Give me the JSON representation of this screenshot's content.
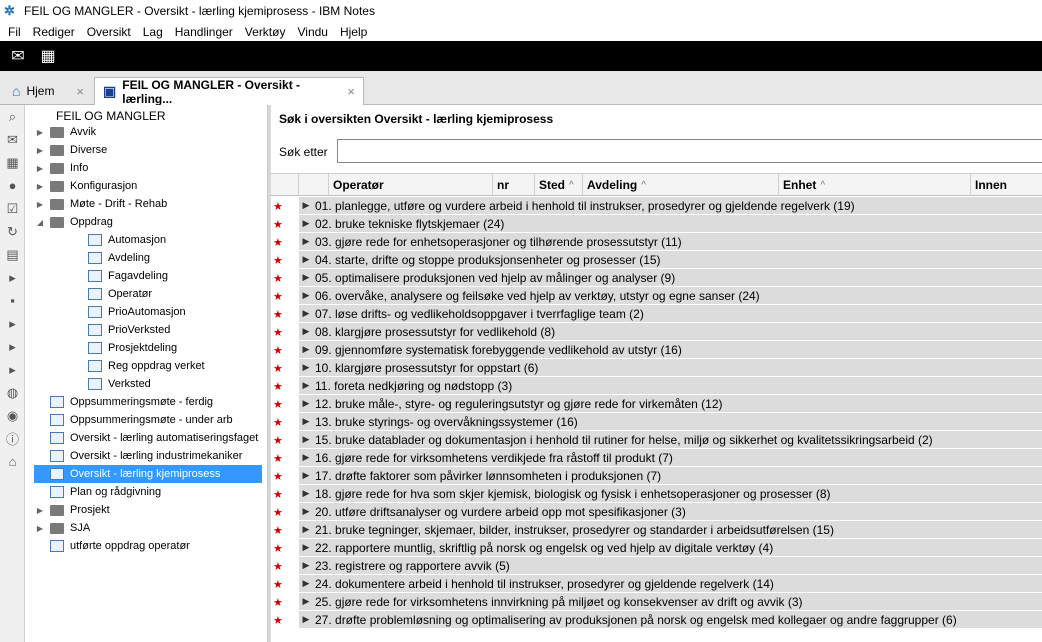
{
  "window": {
    "title": "FEIL OG MANGLER - Oversikt - lærling kjemiprosess - IBM Notes"
  },
  "menu": [
    "Fil",
    "Rediger",
    "Oversikt",
    "Lag",
    "Handlinger",
    "Verktøy",
    "Vindu",
    "Hjelp"
  ],
  "tabs": {
    "home": "Hjem",
    "active": "FEIL OG MANGLER - Oversikt - lærling..."
  },
  "nav": {
    "title": "FEIL OG MANGLER",
    "items": [
      {
        "label": "Avvik",
        "kind": "folder",
        "level": 0,
        "twisty": "▶"
      },
      {
        "label": "Diverse",
        "kind": "folder",
        "level": 0,
        "twisty": "▶"
      },
      {
        "label": "Info",
        "kind": "folder",
        "level": 0,
        "twisty": "▶"
      },
      {
        "label": "Konfigurasjon",
        "kind": "folder",
        "level": 0,
        "twisty": "▶"
      },
      {
        "label": "Møte - Drift - Rehab",
        "kind": "folder",
        "level": 0,
        "twisty": "▶"
      },
      {
        "label": "Oppdrag",
        "kind": "folder",
        "level": 0,
        "twisty": "◢"
      },
      {
        "label": "Automasjon",
        "kind": "view",
        "level": 1,
        "twisty": ""
      },
      {
        "label": "Avdeling",
        "kind": "view",
        "level": 1,
        "twisty": ""
      },
      {
        "label": "Fagavdeling",
        "kind": "view",
        "level": 1,
        "twisty": ""
      },
      {
        "label": "Operatør",
        "kind": "view",
        "level": 1,
        "twisty": ""
      },
      {
        "label": "PrioAutomasjon",
        "kind": "view",
        "level": 1,
        "twisty": ""
      },
      {
        "label": "PrioVerksted",
        "kind": "view",
        "level": 1,
        "twisty": ""
      },
      {
        "label": "Prosjektdeling",
        "kind": "view",
        "level": 1,
        "twisty": ""
      },
      {
        "label": "Reg oppdrag verket",
        "kind": "view",
        "level": 1,
        "twisty": ""
      },
      {
        "label": "Verksted",
        "kind": "view",
        "level": 1,
        "twisty": ""
      },
      {
        "label": "Oppsummeringsmøte - ferdig",
        "kind": "view",
        "level": 0,
        "twisty": ""
      },
      {
        "label": "Oppsummeringsmøte - under arb",
        "kind": "view",
        "level": 0,
        "twisty": ""
      },
      {
        "label": "Oversikt - lærling automatiseringsfaget",
        "kind": "view",
        "level": 0,
        "twisty": ""
      },
      {
        "label": "Oversikt - lærling industrimekaniker",
        "kind": "view",
        "level": 0,
        "twisty": ""
      },
      {
        "label": "Oversikt - lærling kjemiprosess",
        "kind": "view",
        "level": 0,
        "twisty": "",
        "selected": true
      },
      {
        "label": "Plan og rådgivning",
        "kind": "view",
        "level": 0,
        "twisty": ""
      },
      {
        "label": "Prosjekt",
        "kind": "folder",
        "level": 0,
        "twisty": "▶"
      },
      {
        "label": "SJA",
        "kind": "folder",
        "level": 0,
        "twisty": "▶"
      },
      {
        "label": "utførte oppdrag operatør",
        "kind": "view",
        "level": 0,
        "twisty": ""
      }
    ]
  },
  "search": {
    "title": "Søk i oversikten Oversikt - lærling kjemiprosess",
    "label": "Søk etter",
    "value": ""
  },
  "columns": [
    {
      "label": "Operatør",
      "sort": ""
    },
    {
      "label": "nr",
      "sort": ""
    },
    {
      "label": "Sted",
      "sort": "^"
    },
    {
      "label": "Avdeling",
      "sort": "^"
    },
    {
      "label": "Enhet",
      "sort": "^"
    },
    {
      "label": "Innen",
      "sort": ""
    }
  ],
  "rows": [
    "01. planlegge, utføre og vurdere arbeid i henhold til instrukser, prosedyrer og gjeldende regelverk (19)",
    "02. bruke tekniske flytskjemaer (24)",
    "03. gjøre rede for enhetsoperasjoner og tilhørende prosessutstyr (11)",
    "04. starte, drifte og stoppe produksjonsenheter og prosesser (15)",
    "05. optimalisere produksjonen ved hjelp av målinger og analyser (9)",
    "06. overvåke, analysere og feilsøke ved hjelp av verktøy, utstyr og egne sanser (24)",
    "07. løse drifts- og vedlikeholdsoppgaver i tverrfaglige team (2)",
    "08. klargjøre prosessutstyr for vedlikehold (8)",
    "09. gjennomføre systematisk forebyggende vedlikehold av utstyr (16)",
    "10. klargjøre prosessutstyr for oppstart (6)",
    "11. foreta nedkjøring og nødstopp (3)",
    "12. bruke måle-, styre- og reguleringsutstyr og gjøre rede for virkemåten (12)",
    "13. bruke styrings- og overvåkningssystemer (16)",
    "15. bruke datablader og dokumentasjon i henhold til rutiner for helse, miljø og sikkerhet og kvalitetssikringsarbeid (2)",
    "16. gjøre rede for virksomhetens verdikjede fra råstoff til produkt (7)",
    "17. drøfte faktorer som påvirker lønnsomheten i produksjonen (7)",
    "18. gjøre rede for hva som skjer kjemisk, biologisk og fysisk i enhetsoperasjoner og prosesser (8)",
    "20. utføre driftsanalyser og vurdere arbeid opp mot spesifikasjoner (3)",
    "21. bruke tegninger, skjemaer, bilder, instrukser, prosedyrer og standarder i arbeidsutførelsen (15)",
    "22. rapportere muntlig, skriftlig på norsk og engelsk og ved hjelp av digitale verktøy (4)",
    "23. registrere og rapportere avvik (5)",
    "24. dokumentere arbeid i henhold til instrukser, prosedyrer og gjeldende regelverk (14)",
    "25. gjøre rede for virksomhetens innvirkning på miljøet og konsekvenser av drift og avvik (3)",
    "27. drøfte problemløsning og optimalisering av produksjonen på norsk og engelsk med kollegaer og andre faggrupper (6)"
  ],
  "colors": {
    "selection": "#3399ff",
    "star": "#d00000",
    "row_bg": "#dcdcdc"
  }
}
